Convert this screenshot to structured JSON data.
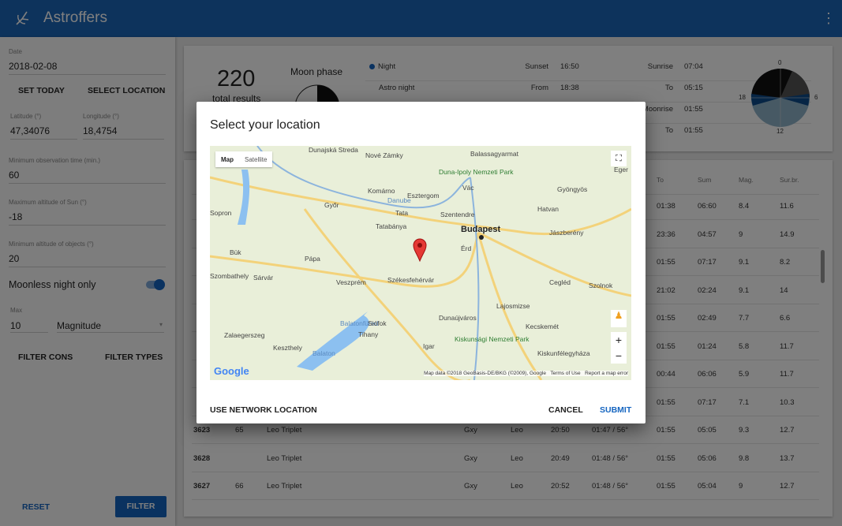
{
  "app": {
    "title": "Astroffers",
    "menu_icon": "more-vert-icon"
  },
  "sidebar": {
    "date": {
      "label": "Date",
      "value": "2018-02-08"
    },
    "set_today": "SET TODAY",
    "select_location": "SELECT LOCATION",
    "latitude": {
      "label": "Latitude (°)",
      "value": "47,34076"
    },
    "longitude": {
      "label": "Longitude (°)",
      "value": "18,4754"
    },
    "min_obs": {
      "label": "Minimum observation time (min.)",
      "value": "60"
    },
    "max_sun": {
      "label": "Maximum altitude of Sun (°)",
      "value": "-18"
    },
    "min_alt": {
      "label": "Minimum altitude of objects (°)",
      "value": "20"
    },
    "moonless": {
      "label": "Moonless night only",
      "checked": true
    },
    "max": {
      "label": "Max",
      "value": "10",
      "unit": "Magnitude"
    },
    "filter_cons": "FILTER CONS",
    "filter_types": "FILTER TYPES",
    "reset": "RESET",
    "filter": "FILTER"
  },
  "summary": {
    "count": "220",
    "count_label": "total results",
    "moon_label": "Moon phase",
    "night": [
      {
        "name": "Night",
        "k1": "Sunset",
        "v1": "16:50",
        "k2": "Sunrise",
        "v2": "07:04"
      },
      {
        "name": "Astro night",
        "k1": "From",
        "v1": "18:38",
        "k2": "To",
        "v2": "05:15"
      },
      {
        "name": "",
        "k1": "",
        "v1": "",
        "k2": "Moonrise",
        "v2": "01:55"
      },
      {
        "name": "",
        "k1": "",
        "v1": "",
        "k2": "To",
        "v2": "01:55"
      }
    ],
    "clock": {
      "top": "0",
      "right": "6",
      "bottom": "12",
      "left": "18"
    }
  },
  "table": {
    "headers": [
      "",
      "",
      "",
      "",
      "",
      "",
      "",
      "To",
      "Sum",
      "Mag.",
      "Sur.br."
    ],
    "rows": [
      [
        "",
        "",
        "",
        "",
        "",
        "",
        "",
        "01:38",
        "06:60",
        "8.4",
        "11.6"
      ],
      [
        "",
        "",
        "",
        "",
        "",
        "",
        "",
        "23:36",
        "04:57",
        "9",
        "14.9"
      ],
      [
        "",
        "",
        "",
        "",
        "",
        "",
        "",
        "01:55",
        "07:17",
        "9.1",
        "8.2"
      ],
      [
        "",
        "",
        "",
        "",
        "",
        "",
        "",
        "21:02",
        "02:24",
        "9.1",
        "14"
      ],
      [
        "",
        "",
        "",
        "",
        "",
        "",
        "",
        "01:55",
        "02:49",
        "7.7",
        "6.6"
      ],
      [
        "",
        "",
        "",
        "",
        "",
        "",
        "",
        "01:55",
        "01:24",
        "5.8",
        "11.7"
      ],
      [
        "",
        "",
        "",
        "",
        "",
        "",
        "",
        "00:44",
        "06:06",
        "5.9",
        "11.7"
      ],
      [
        "",
        "",
        "",
        "",
        "",
        "",
        "",
        "01:55",
        "07:17",
        "7.1",
        "10.3"
      ],
      [
        "3623",
        "65",
        "Leo Triplet",
        "Gxy",
        "Leo",
        "20:50",
        "01:47 / 56°",
        "01:55",
        "05:05",
        "9.3",
        "12.7"
      ],
      [
        "3628",
        "",
        "Leo Triplet",
        "Gxy",
        "Leo",
        "20:49",
        "01:48 / 56°",
        "01:55",
        "05:06",
        "9.8",
        "13.7"
      ],
      [
        "3627",
        "66",
        "Leo Triplet",
        "Gxy",
        "Leo",
        "20:52",
        "01:48 / 56°",
        "01:55",
        "05:04",
        "9",
        "12.7"
      ]
    ]
  },
  "dialog": {
    "title": "Select your location",
    "map": {
      "type_map": "Map",
      "type_satellite": "Satellite",
      "labels": [
        "Dunajská Streda",
        "Nové Zámky",
        "Balassagyarmat",
        "Duna-Ipoly Nemzeti Park",
        "Komárno",
        "Vác",
        "Gyöngyös",
        "Győr",
        "Esztergom",
        "Hatvan",
        "Sopron",
        "Tata",
        "Szentendre",
        "Tatabánya",
        "Budapest",
        "Jászberény",
        "Bük",
        "Pápa",
        "Érd",
        "Szombathely",
        "Sárvár",
        "Székesfehérvár",
        "Cegléd",
        "Szolnok",
        "Veszprém",
        "Lajosmizse",
        "Balatonfüred",
        "Siófok",
        "Dunaújváros",
        "Kecskemét",
        "Zalaegerszeg",
        "Tihany",
        "Keszthely",
        "Kiskunsági Nemzeti Park",
        "Igar",
        "Kiskunfélegyháza",
        "Eger",
        "Danube",
        "Balaton"
      ],
      "attribution": "Map data ©2018 GeoBasis-DE/BKG (©2009), Google",
      "terms": "Terms of Use",
      "report": "Report a map error",
      "logo": "Google"
    },
    "use_network": "USE NETWORK LOCATION",
    "cancel": "CANCEL",
    "submit": "SUBMIT"
  },
  "colors": {
    "primary": "#1a66b8",
    "accent": "#1565c0"
  }
}
